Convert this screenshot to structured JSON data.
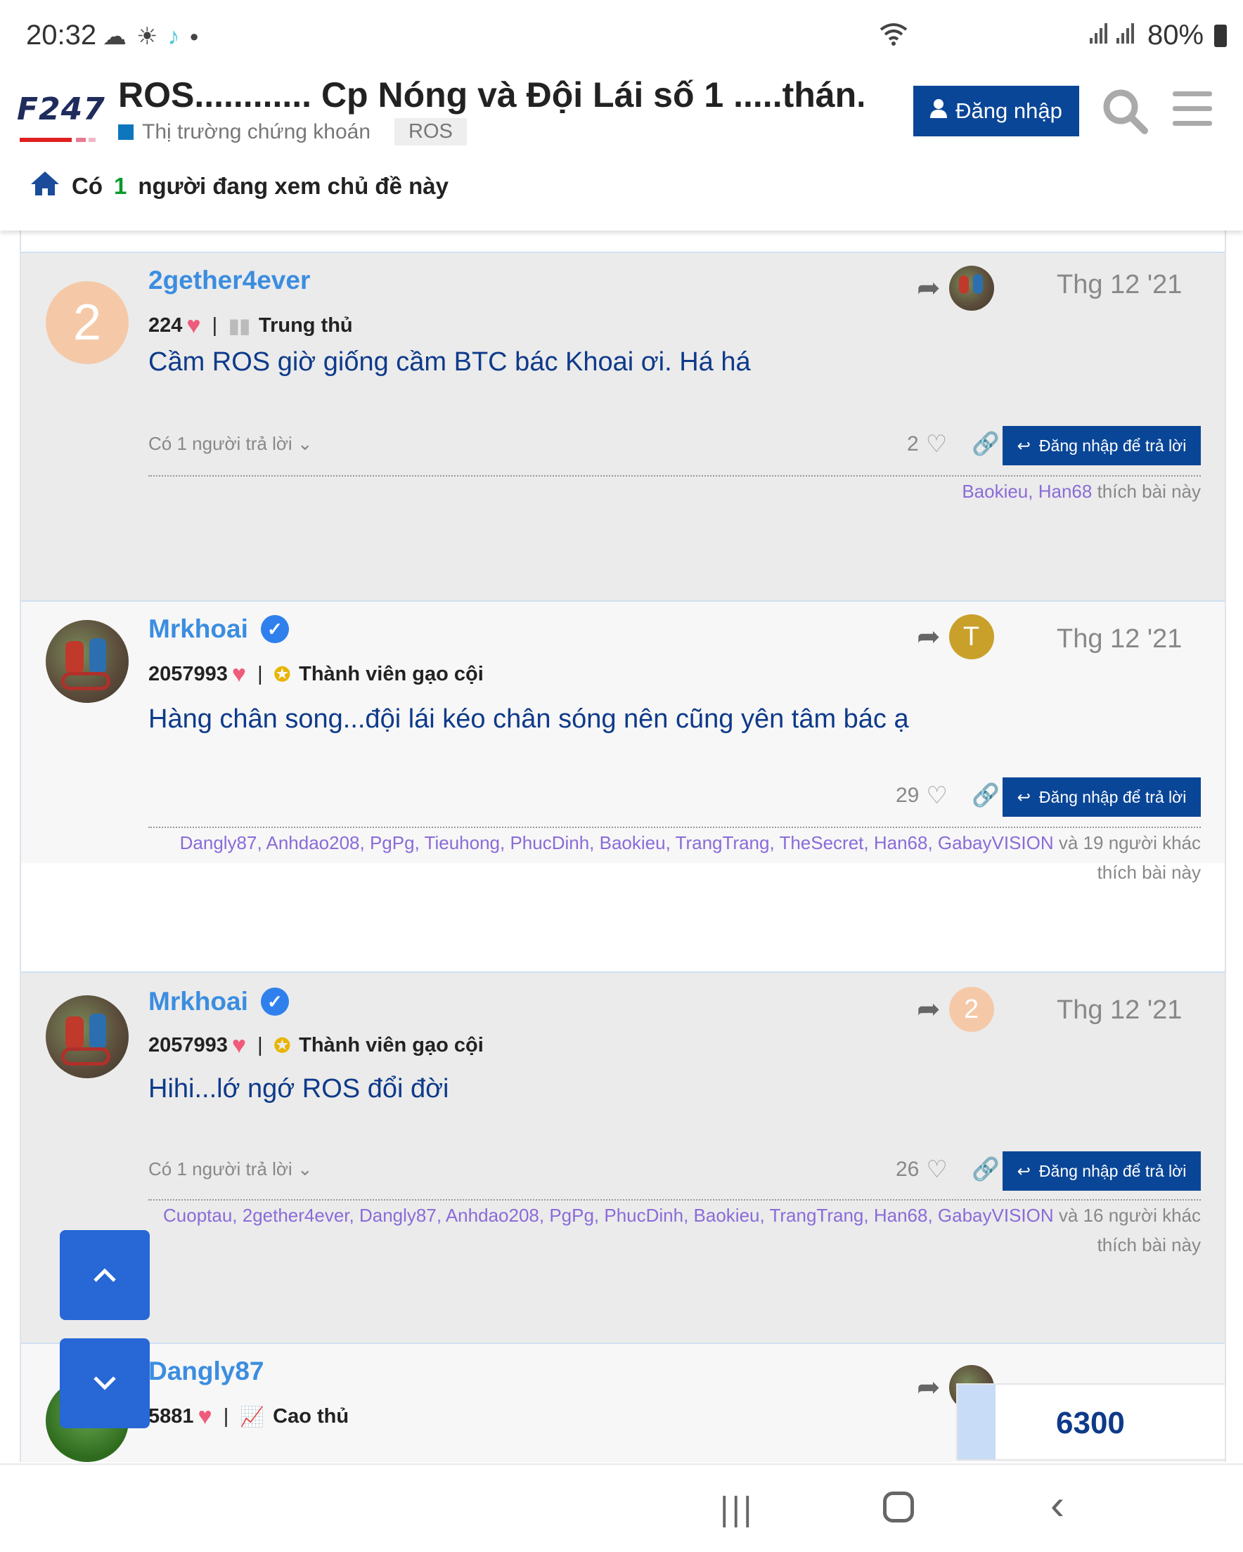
{
  "status_bar": {
    "time": "20:32",
    "battery": "80%",
    "icons": [
      "cloud-icon",
      "weather-icon",
      "tiktok-icon",
      "dot-icon",
      "wifi-icon",
      "signal-icon",
      "battery-icon"
    ]
  },
  "header": {
    "logo": "F247",
    "topic_title": "ROS............ Cp Nóng và Đội Lái số 1 .....thán...",
    "category": "Thị trường chứng khoán",
    "tag": "ROS",
    "login_label": "Đăng nhập",
    "viewers_prefix": "Có",
    "viewers_count": "1",
    "viewers_suffix": "người đang xem chủ đề này"
  },
  "posts": [
    {
      "avatar_letter": "2",
      "username": "2gether4ever",
      "likes_received": "224",
      "rank": "Trung thủ",
      "date": "Thg 12 '21",
      "body": "Cầm ROS giờ giống cầm BTC bác Khoai ơi. Há há",
      "replies_label": "Có 1 người trả lời",
      "like_count": "2",
      "reply_button": "Đăng nhập để trả lời",
      "likers_names": "Baokieu, Han68",
      "likers_suffix": " thích bài này"
    },
    {
      "reply_avatar_letter": "T",
      "username": "Mrkhoai",
      "likes_received": "2057993",
      "rank": "Thành viên gạo cội",
      "date": "Thg 12 '21",
      "body": "Hàng chân song...đội lái kéo chân sóng nên cũng yên tâm bác ạ",
      "like_count": "29",
      "reply_button": "Đăng nhập để trả lời",
      "likers_names": "Dangly87, Anhdao208, PgPg, Tieuhong, PhucDinh, Baokieu, TrangTrang, TheSecret, Han68, GabayVISION",
      "likers_suffix": " và 19 người khác thích bài này"
    },
    {
      "reply_avatar_letter": "2",
      "username": "Mrkhoai",
      "likes_received": "2057993",
      "rank": "Thành viên gạo cội",
      "date": "Thg 12 '21",
      "body": "Hihi...lớ ngớ ROS đổi đời",
      "replies_label": "Có 1 người trả lời",
      "like_count": "26",
      "reply_button": "Đăng nhập để trả lời",
      "likers_names": "Cuoptau, 2gether4ever, Dangly87, Anhdao208, PgPg, PhucDinh, Baokieu, TrangTrang, Han68, GabayVISION",
      "likers_suffix": " và 16 người khác thích bài này"
    },
    {
      "username": "Dangly87",
      "likes_received": "5881",
      "rank": "Cao thủ"
    }
  ],
  "progress_counter": "6300",
  "colors": {
    "primary_button": "#0a4697",
    "username": "#3b8de0",
    "post_body": "#0e3a8a",
    "likers": "#8a6bd8",
    "fab": "#2767d6"
  }
}
